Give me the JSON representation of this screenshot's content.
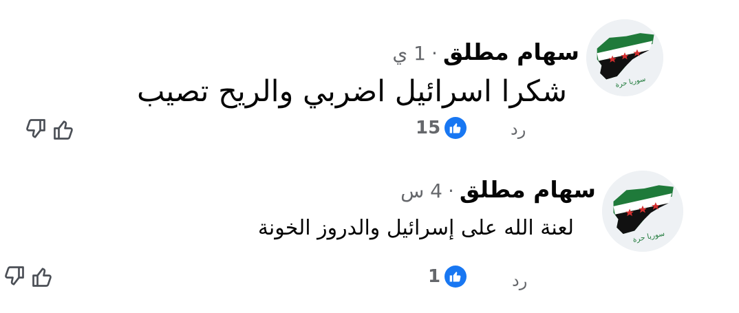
{
  "comments": [
    {
      "author": "سهام مطلق",
      "time": "1 ي",
      "separator": "·",
      "text": "شكرا اسرائيل اضربي والريح تصيب",
      "reply_label": "رد",
      "like_count": "15",
      "avatar_label": "سوريا حرة"
    },
    {
      "author": "سهام مطلق",
      "time": "4 س",
      "separator": "·",
      "text": "لعنة الله على إسرائيل والدروز الخونة",
      "reply_label": "رد",
      "like_count": "1",
      "avatar_label": "سوريا حرة"
    }
  ],
  "colors": {
    "like_blue": "#1877f2",
    "secondary_text": "#65676b",
    "flag_green": "#1f7a3a",
    "flag_red": "#d32f2f",
    "flag_black": "#111111"
  },
  "icons": {
    "like_badge": "thumbs-up-icon",
    "upvote": "thumbs-up-outline-icon",
    "downvote": "thumbs-down-outline-icon",
    "avatar": "syria-map-flag-icon"
  }
}
